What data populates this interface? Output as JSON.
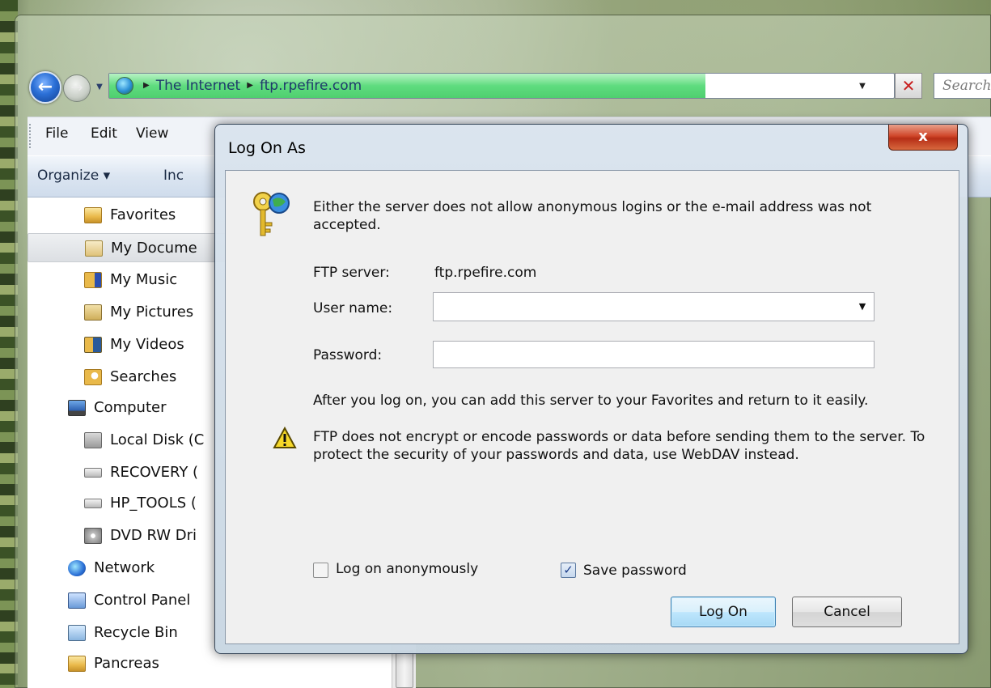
{
  "explorer": {
    "address": {
      "segments": [
        "The Internet",
        "ftp.rpefire.com"
      ],
      "search_placeholder": "Search",
      "progress": 0.76
    },
    "menu": [
      "File",
      "Edit",
      "View"
    ],
    "command_bar": {
      "organize_label": "Organize ▾",
      "partial_label": "Inc"
    },
    "nav_tree": [
      {
        "label": "Favorites",
        "icon": "favorites-folder-icon"
      },
      {
        "label": "My Docume",
        "icon": "documents-folder-icon",
        "selected": true
      },
      {
        "label": "My Music",
        "icon": "music-folder-icon"
      },
      {
        "label": "My Pictures",
        "icon": "pictures-folder-icon"
      },
      {
        "label": "My Videos",
        "icon": "videos-folder-icon"
      },
      {
        "label": "Searches",
        "icon": "searches-folder-icon"
      },
      {
        "label": "Computer",
        "icon": "computer-icon"
      },
      {
        "label": "Local Disk (C",
        "icon": "local-disk-icon"
      },
      {
        "label": "RECOVERY (",
        "icon": "drive-icon"
      },
      {
        "label": "HP_TOOLS (",
        "icon": "drive-icon"
      },
      {
        "label": "DVD RW Dri",
        "icon": "dvd-drive-icon"
      },
      {
        "label": "Network",
        "icon": "network-icon"
      },
      {
        "label": "Control Panel",
        "icon": "control-panel-icon"
      },
      {
        "label": "Recycle Bin",
        "icon": "recycle-bin-icon"
      },
      {
        "label": "Pancreas",
        "icon": "folder-icon"
      }
    ]
  },
  "dialog": {
    "title": "Log On As",
    "close_label": "x",
    "message": "Either the server does not allow anonymous logins or the e-mail address was not accepted.",
    "ftp_server_label": "FTP server:",
    "ftp_server_value": "ftp.rpefire.com",
    "username_label": "User name:",
    "username_value": "",
    "password_label": "Password:",
    "password_value": "",
    "favorites_note": "After you log on, you can add this server to your Favorites and return to it easily.",
    "warning": "FTP does not encrypt or encode passwords or data before sending them to the server.  To protect the security of your passwords and data, use WebDAV instead.",
    "anonymous_label": "Log on anonymously",
    "anonymous_checked": false,
    "save_password_label": "Save password",
    "save_password_checked": true,
    "logon_button": "Log On",
    "cancel_button": "Cancel"
  }
}
